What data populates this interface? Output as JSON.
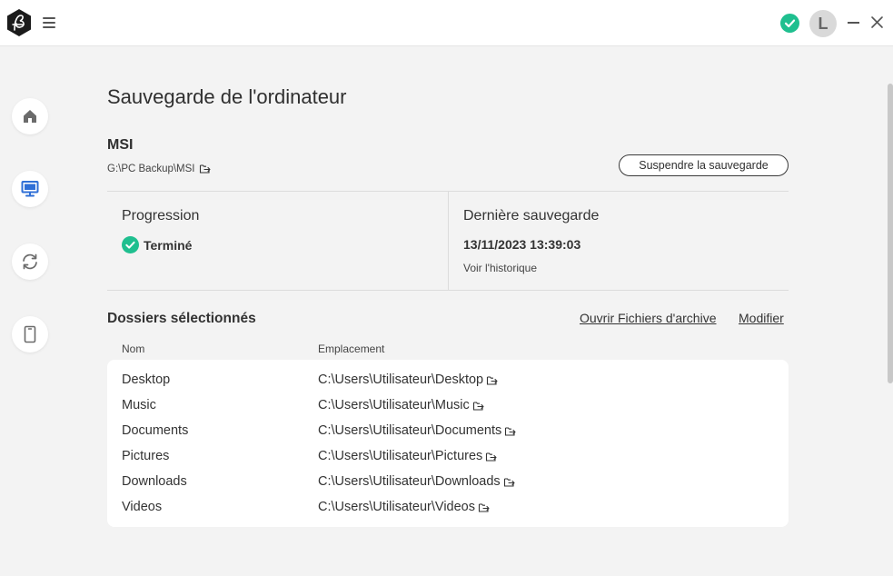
{
  "header": {
    "menu_icon": "hamburger-icon",
    "status_icon": "check-circle-icon",
    "avatar_letter": "L",
    "accent_color": "#1fbf8f"
  },
  "sidebar": {
    "items": [
      {
        "name": "home",
        "icon": "home-icon"
      },
      {
        "name": "computer-backup",
        "icon": "monitor-icon",
        "active": true
      },
      {
        "name": "sync",
        "icon": "sync-icon"
      },
      {
        "name": "device",
        "icon": "phone-icon"
      }
    ]
  },
  "main": {
    "title": "Sauvegarde de l'ordinateur",
    "device_name": "MSI",
    "device_path": "G:\\PC Backup\\MSI",
    "suspend_button": "Suspendre la sauvegarde",
    "progress_label": "Progression",
    "progress_status": "Terminé",
    "last_backup_label": "Dernière sauvegarde",
    "last_backup_date": "13/11/2023 13:39:03",
    "history_link": "Voir l'historique",
    "folders_title": "Dossiers sélectionnés",
    "open_archive_link": "Ouvrir Fichiers d'archive",
    "modify_link": "Modifier",
    "columns": {
      "name": "Nom",
      "location": "Emplacement"
    },
    "folders": [
      {
        "name": "Desktop",
        "location": "C:\\Users\\Utilisateur\\Desktop"
      },
      {
        "name": "Music",
        "location": "C:\\Users\\Utilisateur\\Music"
      },
      {
        "name": "Documents",
        "location": "C:\\Users\\Utilisateur\\Documents"
      },
      {
        "name": "Pictures",
        "location": "C:\\Users\\Utilisateur\\Pictures"
      },
      {
        "name": "Downloads",
        "location": "C:\\Users\\Utilisateur\\Downloads"
      },
      {
        "name": "Videos",
        "location": "C:\\Users\\Utilisateur\\Videos"
      }
    ]
  }
}
